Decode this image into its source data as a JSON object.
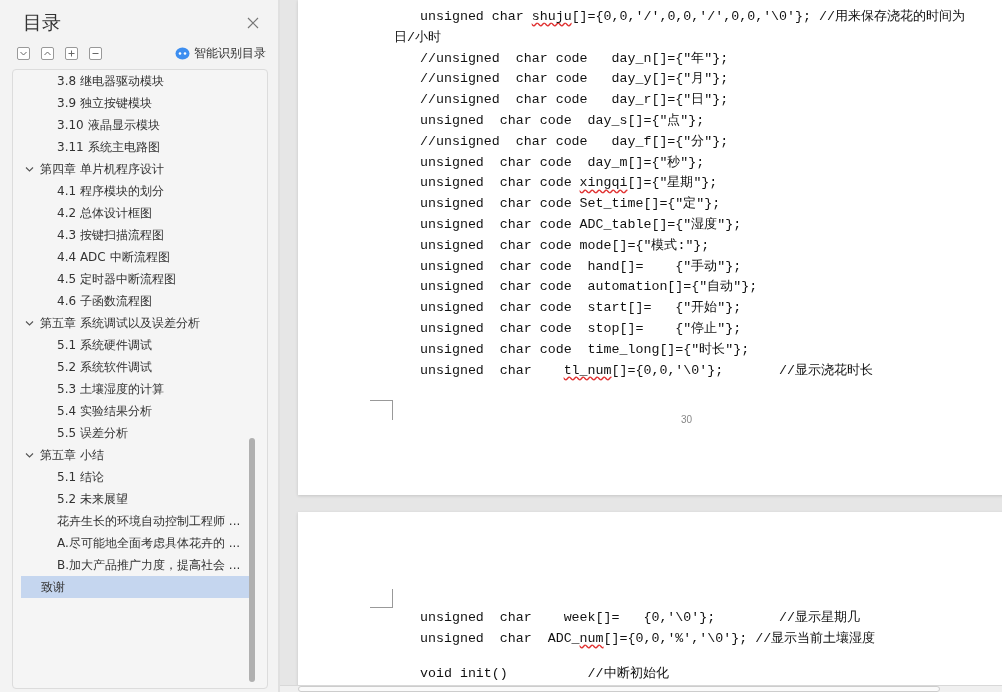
{
  "toc_panel": {
    "title": "目录",
    "smart_toc_button": "智能识别目录",
    "items": [
      {
        "kind": "section",
        "label": "3.8 继电器驱动模块",
        "selected": false
      },
      {
        "kind": "section",
        "label": "3.9 独立按键模块",
        "selected": false
      },
      {
        "kind": "section",
        "label": "3.10 液晶显示模块",
        "selected": false
      },
      {
        "kind": "section",
        "label": "3.11 系统主电路图",
        "selected": false
      },
      {
        "kind": "chapter",
        "label": "第四章  单片机程序设计",
        "selected": false,
        "expanded": true,
        "children": [
          {
            "kind": "section",
            "label": "4.1 程序模块的划分",
            "selected": false
          },
          {
            "kind": "section",
            "label": "4.2 总体设计框图",
            "selected": false
          },
          {
            "kind": "section",
            "label": "4.3 按键扫描流程图",
            "selected": false
          },
          {
            "kind": "section",
            "label": "4.4 ADC 中断流程图",
            "selected": false
          },
          {
            "kind": "section",
            "label": "4.5  定时器中断流程图",
            "selected": false
          },
          {
            "kind": "section",
            "label": "4.6 子函数流程图",
            "selected": false
          }
        ]
      },
      {
        "kind": "chapter",
        "label": "第五章  系统调试以及误差分析",
        "selected": false,
        "expanded": true,
        "children": [
          {
            "kind": "section",
            "label": "5.1  系统硬件调试",
            "selected": false
          },
          {
            "kind": "section",
            "label": "5.2  系统软件调试",
            "selected": false
          },
          {
            "kind": "section",
            "label": "5.3 土壤湿度的计算",
            "selected": false
          },
          {
            "kind": "section",
            "label": "5.4 实验结果分析",
            "selected": false
          },
          {
            "kind": "section",
            "label": "5.5 误差分析",
            "selected": false
          }
        ]
      },
      {
        "kind": "chapter",
        "label": "第五章  小结",
        "selected": false,
        "expanded": true,
        "children": [
          {
            "kind": "section",
            "label": "5.1 结论",
            "selected": false
          },
          {
            "kind": "section",
            "label": "5.2  未来展望",
            "selected": false
          },
          {
            "kind": "section",
            "label": "花卉生长的环境自动控制工程师 ...",
            "selected": false
          },
          {
            "kind": "section",
            "label": "A.尽可能地全面考虑具体花卉的 ...",
            "selected": false
          },
          {
            "kind": "section",
            "label": "B.加大产品推广力度，提高社会 ...",
            "selected": false
          }
        ]
      },
      {
        "kind": "leaf",
        "label": "致谢",
        "selected": true
      }
    ]
  },
  "document": {
    "pages": [
      {
        "page_number": "30",
        "lines": [
          {
            "kind": "code",
            "segments": [
              {
                "text": "unsigned char ",
                "misspelled": false
              },
              {
                "text": "shuju",
                "misspelled": true
              },
              {
                "text": "[]={0,0,'/',0,0,'/',0,0,'\\0'}; //用来保存浇花的时间为",
                "misspelled": false
              }
            ]
          },
          {
            "kind": "wrap",
            "segments": [
              {
                "text": "日/小时",
                "misspelled": false
              }
            ]
          },
          {
            "kind": "code",
            "segments": [
              {
                "text": "//unsigned  char code   day_n[]={\"年\"};",
                "misspelled": false
              }
            ]
          },
          {
            "kind": "code",
            "segments": [
              {
                "text": "//unsigned  char code   day_y[]={\"月\"};",
                "misspelled": false
              }
            ]
          },
          {
            "kind": "code",
            "segments": [
              {
                "text": "//unsigned  char code   day_r[]={\"日\"};",
                "misspelled": false
              }
            ]
          },
          {
            "kind": "code",
            "segments": [
              {
                "text": "unsigned  char code  day_s[]={\"点\"};",
                "misspelled": false
              }
            ]
          },
          {
            "kind": "code",
            "segments": [
              {
                "text": "//unsigned  char code   day_f[]={\"分\"};",
                "misspelled": false
              }
            ]
          },
          {
            "kind": "code",
            "segments": [
              {
                "text": "unsigned  char code  day_m[]={\"秒\"};",
                "misspelled": false
              }
            ]
          },
          {
            "kind": "code",
            "segments": [
              {
                "text": "unsigned  char code ",
                "misspelled": false
              },
              {
                "text": "xingqi",
                "misspelled": true
              },
              {
                "text": "[]={\"星期\"};",
                "misspelled": false
              }
            ]
          },
          {
            "kind": "code",
            "segments": [
              {
                "text": "unsigned  char code Set_time[]={\"定\"};",
                "misspelled": false
              }
            ]
          },
          {
            "kind": "code",
            "segments": [
              {
                "text": "unsigned  char code ADC_table[]={\"湿度\"};",
                "misspelled": false
              }
            ]
          },
          {
            "kind": "code",
            "segments": [
              {
                "text": "unsigned  char code mode[]={\"模式:\"};",
                "misspelled": false
              }
            ]
          },
          {
            "kind": "code",
            "segments": [
              {
                "text": "unsigned  char code  hand[]=    {\"手动\"};",
                "misspelled": false
              }
            ]
          },
          {
            "kind": "code",
            "segments": [
              {
                "text": "unsigned  char code  automation[]={\"自动\"};",
                "misspelled": false
              }
            ]
          },
          {
            "kind": "code",
            "segments": [
              {
                "text": "unsigned  char code  start[]=   {\"开始\"};",
                "misspelled": false
              }
            ]
          },
          {
            "kind": "code",
            "segments": [
              {
                "text": "unsigned  char code  stop[]=    {\"停止\"};",
                "misspelled": false
              }
            ]
          },
          {
            "kind": "code",
            "segments": [
              {
                "text": "unsigned  char code  time_long[]={\"时长\"};",
                "misspelled": false
              }
            ]
          },
          {
            "kind": "code",
            "segments": [
              {
                "text": "unsigned  char    ",
                "misspelled": false
              },
              {
                "text": "tl_num",
                "misspelled": true
              },
              {
                "text": "[]={0,0,'\\0'};       //显示浇花时长",
                "misspelled": false
              }
            ]
          }
        ]
      },
      {
        "lines": [
          {
            "kind": "code",
            "segments": [
              {
                "text": "unsigned  char    week[]=   {0,'\\0'};        //显示星期几",
                "misspelled": false
              }
            ]
          },
          {
            "kind": "code",
            "segments": [
              {
                "text": "unsigned  char  ADC_",
                "misspelled": false
              },
              {
                "text": "num",
                "misspelled": true
              },
              {
                "text": "[]={0,0,'%','\\0'}; //显示当前土壤湿度",
                "misspelled": false
              }
            ]
          },
          {
            "kind": "blank"
          },
          {
            "kind": "code",
            "segments": [
              {
                "text": "void init()          //中断初始化",
                "misspelled": false
              }
            ]
          }
        ]
      }
    ]
  }
}
